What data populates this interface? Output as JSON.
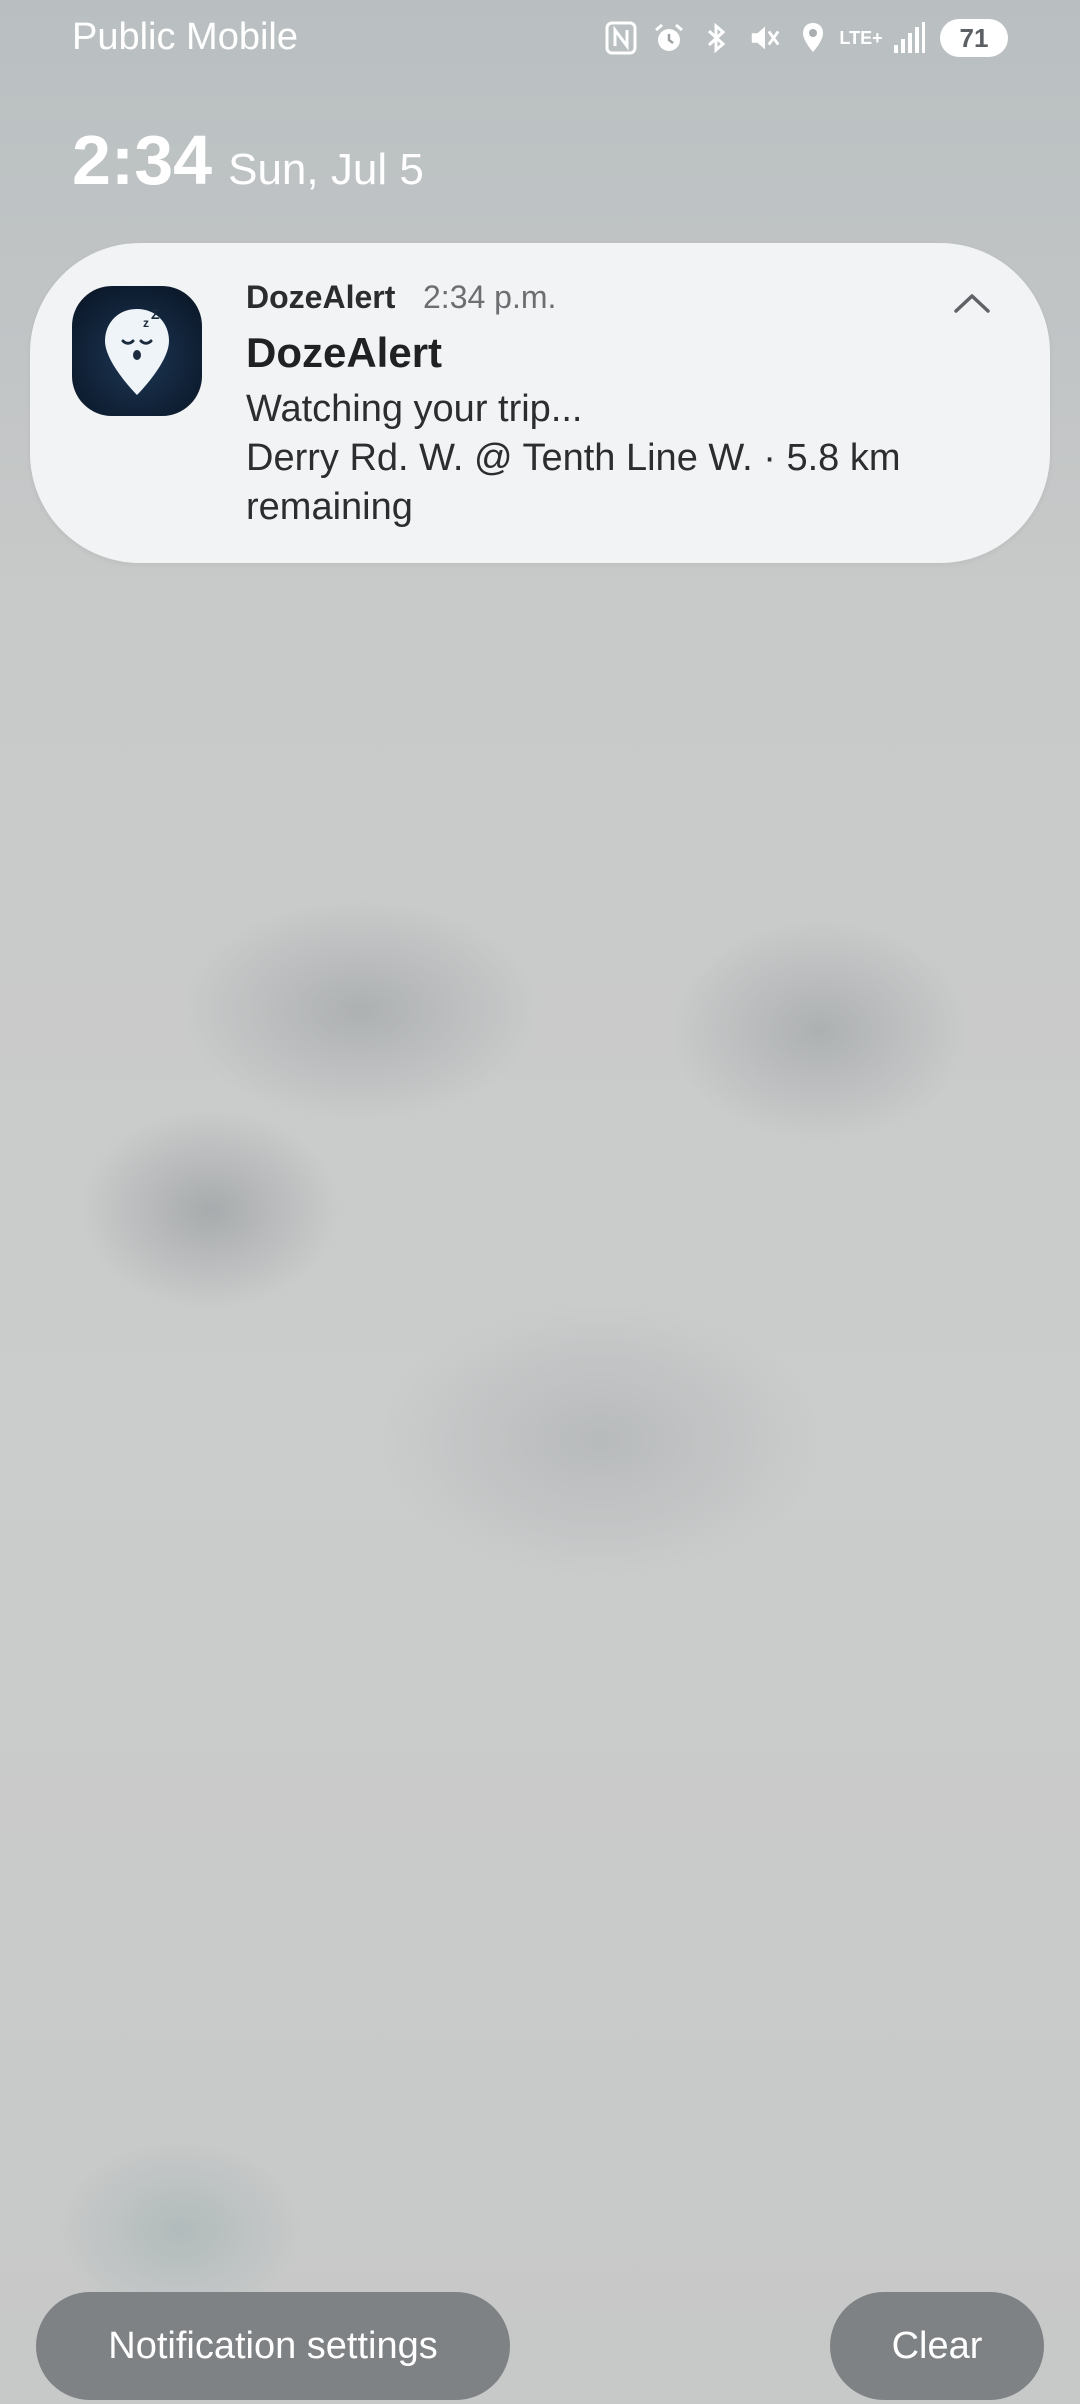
{
  "status_bar": {
    "carrier": "Public Mobile",
    "icons": [
      "nfc-icon",
      "alarm-icon",
      "bluetooth-icon",
      "vibrate-mute-icon",
      "location-icon",
      "lte-signal-icon",
      "signal-strength-icon"
    ],
    "lte_label": "LTE+",
    "battery": "71"
  },
  "clock": {
    "time": "2:34",
    "date": "Sun, Jul 5"
  },
  "notification": {
    "app_name": "DozeAlert",
    "time": "2:34 p.m.",
    "title": "DozeAlert",
    "line1": "Watching your trip...",
    "line2": "Derry Rd. W. @ Tenth Line W. · 5.8 km remaining",
    "icon": "sleeping-location-pin-icon",
    "collapse_icon": "chevron-up-icon"
  },
  "actions": {
    "settings_label": "Notification settings",
    "clear_label": "Clear"
  }
}
